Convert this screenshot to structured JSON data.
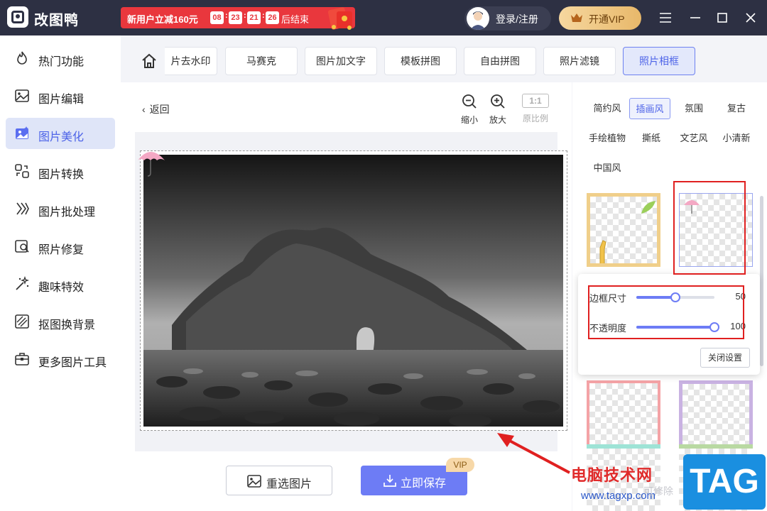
{
  "app": {
    "name": "改图鸭"
  },
  "promo": {
    "label": "新用户立减160元",
    "countdown": [
      "08",
      "23",
      "21",
      "26"
    ],
    "suffix": "后结束"
  },
  "account": {
    "login_label": "登录/注册",
    "vip_label": "开通VIP"
  },
  "sidebar": {
    "items": [
      {
        "label": "热门功能",
        "icon": "flame-icon"
      },
      {
        "label": "图片编辑",
        "icon": "image-edit-icon"
      },
      {
        "label": "图片美化",
        "icon": "image-beautify-icon",
        "active": true
      },
      {
        "label": "图片转换",
        "icon": "convert-icon"
      },
      {
        "label": "图片批处理",
        "icon": "batch-icon"
      },
      {
        "label": "照片修复",
        "icon": "repair-icon"
      },
      {
        "label": "趣味特效",
        "icon": "sparkle-icon"
      },
      {
        "label": "抠图换背景",
        "icon": "cutout-icon"
      },
      {
        "label": "更多图片工具",
        "icon": "toolbox-icon"
      }
    ]
  },
  "tools": {
    "items": [
      "片去水印",
      "马赛克",
      "图片加文字",
      "模板拼图",
      "自由拼图",
      "照片滤镜",
      "照片相框"
    ],
    "active": "照片相框"
  },
  "canvas": {
    "back_label": "返回",
    "zoom_out_label": "缩小",
    "zoom_in_label": "放大",
    "ratio_box": "1:1",
    "ratio_label": "原比例"
  },
  "actions": {
    "reselect_label": "重选图片",
    "save_label": "立即保存",
    "vip_tag": "VIP"
  },
  "frame_categories": [
    "简约风",
    "插画风",
    "氛围",
    "复古",
    "手绘植物",
    "撕纸",
    "文艺风",
    "小清新",
    "中国风"
  ],
  "active_category": "插画风",
  "settings": {
    "border_size_label": "边框尺寸",
    "border_size_value": 50,
    "border_size_fraction": 0.5,
    "opacity_label": "不透明度",
    "opacity_value": 100,
    "opacity_fraction": 1.0,
    "close_label": "关闭设置"
  },
  "watermark": {
    "text": "电脑技术网",
    "url": "www.tagxp.com",
    "logo": "TAG",
    "ghost": "可修除"
  },
  "colors": {
    "accent": "#6d7cf5",
    "titlebar": "#2d3043",
    "promo": "#e9373d",
    "highlight": "#e02020"
  }
}
